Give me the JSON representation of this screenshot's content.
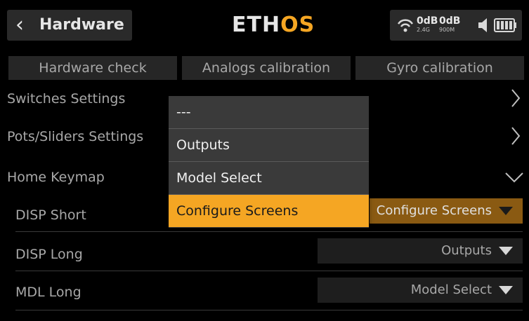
{
  "header": {
    "title": "Hardware",
    "logo_main": "ETH",
    "logo_accent": "OS",
    "rssi_left": "0dB",
    "rssi_right": "0dB",
    "band_left": "2.4G",
    "band_right": "900M"
  },
  "tabs": [
    {
      "label": "Hardware check"
    },
    {
      "label": "Analogs calibration"
    },
    {
      "label": "Gyro calibration"
    }
  ],
  "rows": {
    "switches": "Switches Settings",
    "pots": "Pots/Sliders Settings",
    "keymap": "Home Keymap",
    "disp_short": "DISP Short",
    "disp_long": "DISP Long",
    "mdl_long": "MDL Long"
  },
  "values": {
    "disp_short": "Configure Screens",
    "disp_long": "Outputs",
    "mdl_long": "Model Select"
  },
  "dropdown": {
    "options": [
      "---",
      "Outputs",
      "Model Select",
      "Configure Screens"
    ],
    "selected": "Configure Screens"
  },
  "colors": {
    "accent": "#f5a623",
    "background": "#000000",
    "panel": "#2a2a2a"
  }
}
